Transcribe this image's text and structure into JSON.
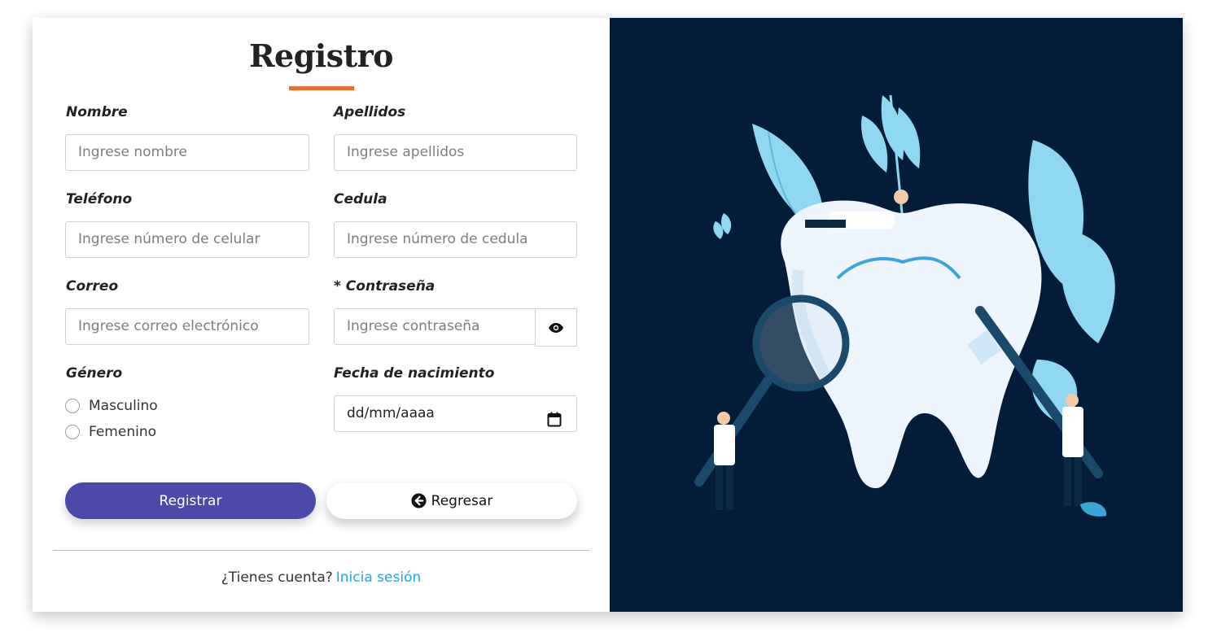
{
  "form": {
    "title": "Registro",
    "fields": {
      "nombre": {
        "label": "Nombre",
        "placeholder": "Ingrese nombre"
      },
      "apellidos": {
        "label": "Apellidos",
        "placeholder": "Ingrese apellidos"
      },
      "telefono": {
        "label": "Teléfono",
        "placeholder": "Ingrese número de celular"
      },
      "cedula": {
        "label": "Cedula",
        "placeholder": "Ingrese número de cedula"
      },
      "correo": {
        "label": "Correo",
        "placeholder": "Ingrese correo electrónico"
      },
      "contrasena": {
        "label": "* Contraseña",
        "placeholder": "Ingrese contraseña"
      },
      "genero": {
        "label": "Género",
        "options": [
          "Masculino",
          "Femenino"
        ]
      },
      "fecha": {
        "label": "Fecha de nacimiento",
        "placeholder": "dd/mm/aaaa"
      }
    },
    "buttons": {
      "register": "Registrar",
      "back": "Regresar"
    },
    "footer": {
      "question": "¿Tienes cuenta?",
      "link": "Inicia sesión"
    }
  },
  "icons": {
    "password_toggle": "eye-icon",
    "date_picker": "calendar-icon",
    "back": "arrow-left-circle-icon"
  },
  "colors": {
    "accent": "#f06a2c",
    "primary_button": "#4d49a9",
    "link": "#22a6e0",
    "illustration_background": "#031c3a"
  }
}
